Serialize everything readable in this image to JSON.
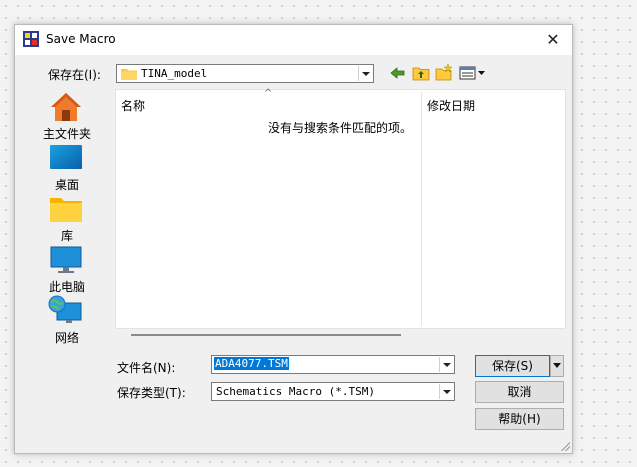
{
  "window": {
    "title": "Save Macro",
    "close_glyph": "✕"
  },
  "location": {
    "label": "保存在(I):",
    "folder": "TINA_model"
  },
  "toolbar": {
    "icons": [
      "back-arrow-icon",
      "up-folder-icon",
      "new-folder-icon",
      "view-menu-icon"
    ]
  },
  "places": [
    {
      "label": "主文件夹",
      "icon": "home-icon"
    },
    {
      "label": "桌面",
      "icon": "desktop-icon"
    },
    {
      "label": "库",
      "icon": "library-folder-icon"
    },
    {
      "label": "此电脑",
      "icon": "monitor-icon"
    },
    {
      "label": "网络",
      "icon": "network-icon"
    }
  ],
  "list": {
    "col_name": "名称",
    "col_modified": "修改日期",
    "sort_glyph": "^",
    "empty_message": "没有与搜索条件匹配的项。"
  },
  "filename": {
    "label": "文件名(N):",
    "value": "ADA4077.TSM"
  },
  "filetype": {
    "label": "保存类型(T):",
    "value": "Schematics Macro (*.TSM)"
  },
  "buttons": {
    "save": "保存(S)",
    "cancel": "取消",
    "help": "帮助(H)"
  },
  "colors": {
    "selection": "#0078d7",
    "folder": "#ffc83d",
    "accent": "#0078d7"
  }
}
